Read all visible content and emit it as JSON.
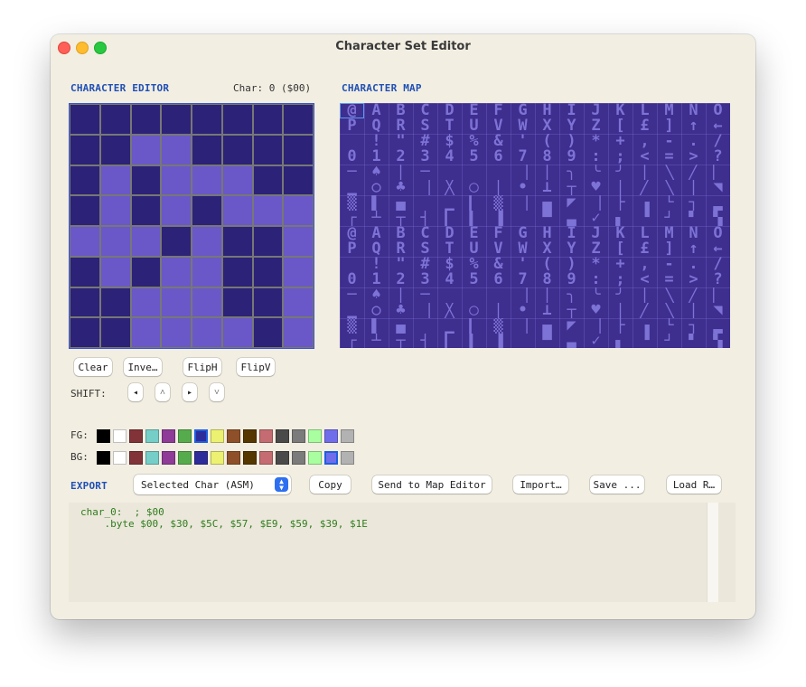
{
  "window": {
    "title": "Character Set Editor"
  },
  "editor": {
    "label": "CHARACTER EDITOR",
    "char_info": "Char: 0 ($00)",
    "fg_color": "#2c2277",
    "bg_color": "#6a58c8",
    "bitmap": [
      "11111111",
      "11001111",
      "10100011",
      "10101000",
      "00010110",
      "10100110",
      "11000110",
      "11000010"
    ]
  },
  "buttons": {
    "clear": "Clear",
    "invert": "Inve…",
    "fliph": "FlipH",
    "flipv": "FlipV"
  },
  "shift": {
    "label": "SHIFT:",
    "left": "◂",
    "up": "˄",
    "right": "▸",
    "down": "˅"
  },
  "map": {
    "label": "CHARACTER MAP",
    "rows": [
      "@ABCDEFGHIJKLMNO",
      "PQRSTUVWXYZ[£]↑←",
      " !\"#$%&'()*+,-./",
      "0123456789:;<=>?",
      "─♠│─▔▔▔▕│╮╰╯│╲╱▏",
      "▁○♣▕╳◯│•⊥┬♥│╱╲│◥",
      "▒▌▄▔▁▎▒▕▄◤▕├▗└┐▂",
      "┌┴┬┤▎▍▐▔▀▃✓▖▝┘▘▚",
      "@ABCDEFGHIJKLMNO",
      "PQRSTUVWXYZ[£]↑←",
      " !\"#$%&'()*+,-./",
      "0123456789:;<=>?",
      "─♠│─▔▔▔▕│╮╰╯│╲╱▏",
      "▁○♣▕╳◯│•⊥┬♥│╱╲│◥",
      "▒▌▄▔▁▎▒▕▄◤▕├▗└┐▂",
      "┌┴┬┤▎▍▐▔▀▃✓▖▝┘▘▚"
    ]
  },
  "palette": {
    "fg_label": "FG:",
    "bg_label": "BG:",
    "colors": [
      "#000000",
      "#ffffff",
      "#813338",
      "#75cec8",
      "#8e3c97",
      "#56ac4d",
      "#2e2c9b",
      "#edf171",
      "#8e5029",
      "#553800",
      "#c46c71",
      "#4a4a4a",
      "#7b7b7b",
      "#a9ff9f",
      "#706deb",
      "#b2b2b2"
    ],
    "fg_selected": 6,
    "bg_selected": 14
  },
  "export": {
    "label": "EXPORT",
    "format_value": "Selected Char (ASM)",
    "copy": "Copy",
    "send_to_map": "Send to Map Editor",
    "import": "Import…",
    "save": "Save ...",
    "load": "Load R…",
    "code": "char_0:  ; $00\n    .byte $00, $30, $5C, $57, $E9, $59, $39, $1E"
  }
}
